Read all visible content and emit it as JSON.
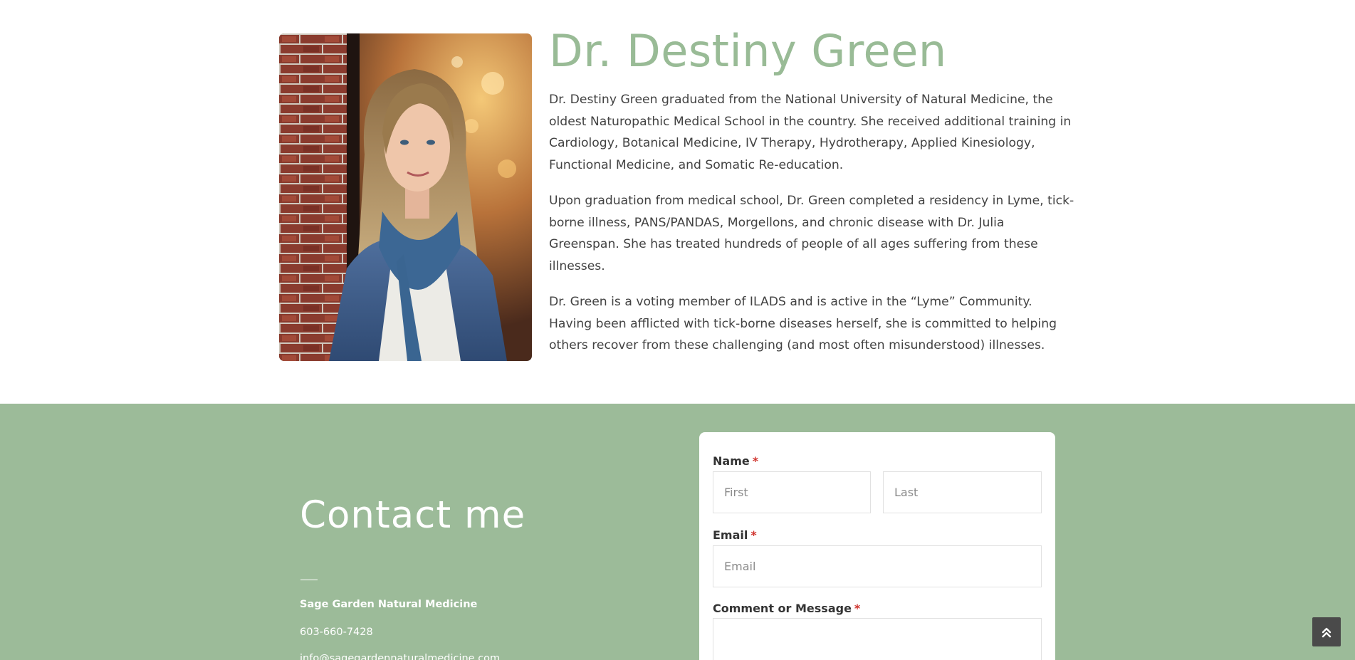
{
  "bio": {
    "title": "Dr. Destiny Green",
    "paragraphs": [
      "Dr. Destiny Green graduated from the National University of Natural Medicine, the oldest Naturopathic Medical School in the country. She received additional training in Cardiology, Botanical Medicine, IV Therapy, Hydrotherapy, Applied Kinesiology, Functional Medicine, and Somatic Re-education.",
      "Upon graduation from medical school, Dr. Green completed a residency in Lyme, tick-borne illness, PANS/PANDAS, Morgellons, and chronic disease with Dr. Julia Greenspan. She has treated hundreds of people of all ages suffering from these illnesses.",
      "Dr. Green is a voting member of ILADS and is active in the “Lyme” Community. Having been afflicted with tick-borne diseases herself, she is committed to helping others recover from these challenging (and most often misunderstood) illnesses."
    ]
  },
  "contact": {
    "title": "Contact me",
    "org": "Sage Garden Natural Medicine",
    "phone": "603-660-7428",
    "email": "info@sagegardennaturalmedicine.com"
  },
  "form": {
    "name_label": "Name",
    "first_placeholder": "First",
    "last_placeholder": "Last",
    "email_label": "Email",
    "email_placeholder": "Email",
    "message_label": "Comment or Message",
    "required_mark": "*"
  },
  "colors": {
    "title_green": "#99bb96",
    "section_green": "#9cbb99",
    "required_red": "#d0332d"
  },
  "icons": {
    "scroll_top": "double-chevron-up-icon"
  }
}
